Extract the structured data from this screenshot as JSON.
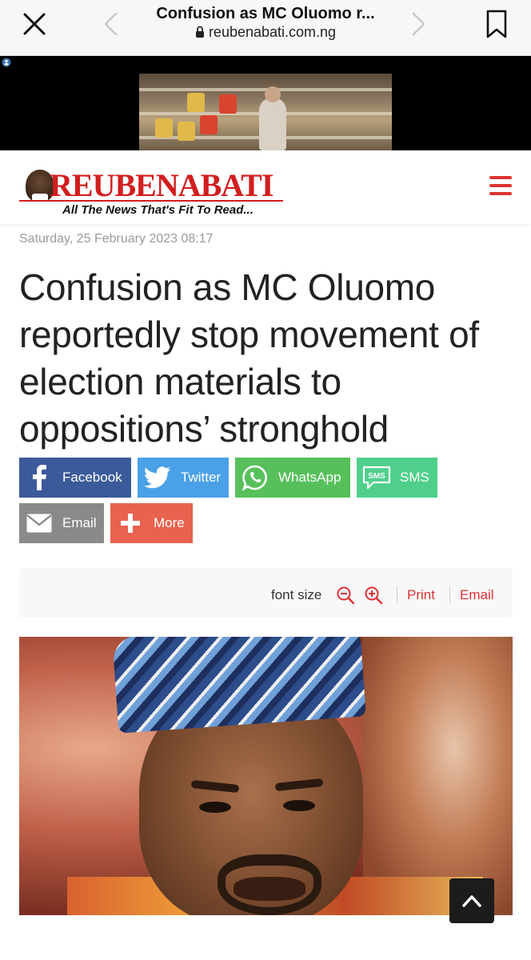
{
  "browser": {
    "title": "Confusion as MC Oluomo r...",
    "url": "reubenabati.com.ng"
  },
  "ad": {
    "close_label": "✕"
  },
  "site": {
    "logo_text": "REUBENABATI",
    "tagline": "All The News That's Fit To Read..."
  },
  "article": {
    "date": "Saturday, 25 February 2023 08:17",
    "headline": "Confusion as MC Oluomo reportedly stop movement of election materials to oppositions’ stronghold"
  },
  "share": {
    "facebook": "Facebook",
    "twitter": "Twitter",
    "whatsapp": "WhatsApp",
    "sms": "SMS",
    "sms_icon_text": "SMS",
    "email": "Email",
    "more": "More"
  },
  "tools": {
    "font_size_label": "font size",
    "print_label": "Print",
    "email_label": "Email"
  },
  "icons": {
    "close": "close-icon",
    "back": "chevron-left-icon",
    "forward": "chevron-right-icon",
    "bookmark": "bookmark-icon",
    "lock": "lock-icon",
    "menu": "hamburger-menu-icon",
    "zoom_out": "zoom-out-icon",
    "zoom_in": "zoom-in-icon",
    "scroll_top": "chevron-up-icon"
  },
  "colors": {
    "brand_red": "#d21e1e",
    "facebook": "#3b5a9a",
    "twitter": "#4aa1e8",
    "whatsapp": "#57c05b",
    "sms": "#4fcf8a",
    "email": "#8a8a8a",
    "more": "#e8624f"
  }
}
